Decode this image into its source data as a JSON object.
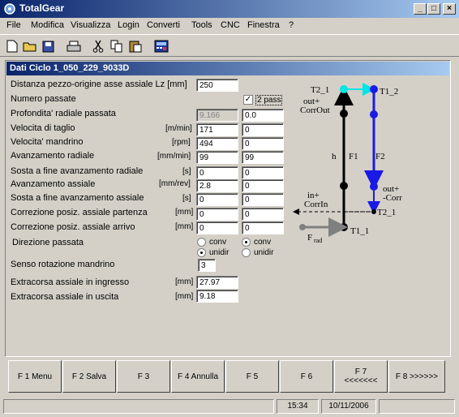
{
  "window": {
    "title": "TotalGear"
  },
  "menu": [
    "File",
    "Modifica",
    "Visualizza",
    "Login",
    "Converti",
    "Tools",
    "CNC",
    "Finestra",
    "?"
  ],
  "panel": {
    "title": "Dati Ciclo   1_050_229_9033D"
  },
  "fields": {
    "lz": {
      "label": "Distanza pezzo-origine asse  assiale  Lz  [mm]",
      "value": "250"
    },
    "passate": {
      "label": "Numero passate",
      "check_label": "2 pass",
      "checked": true
    },
    "profondita": {
      "label": "Profondita' radiale passata",
      "v1": "9.166",
      "v2": "0.0"
    },
    "vtaglio": {
      "label": "Velocita di taglio",
      "unit": "[m/min]",
      "v1": "171",
      "v2": "0"
    },
    "vmandrino": {
      "label": "Velocita' mandrino",
      "unit": "[rpm]",
      "v1": "494",
      "v2": "0"
    },
    "avrad": {
      "label": "Avanzamento radiale",
      "unit": "[mm/min]",
      "v1": "99",
      "v2": "99"
    },
    "sostarad": {
      "label": "Sosta a fine avanzamento radiale",
      "unit": "[s]",
      "v1": "0",
      "v2": "0"
    },
    "avass": {
      "label": "Avanzamento assiale",
      "unit": "[mm/rev]",
      "v1": "2.8",
      "v2": "0"
    },
    "sostaass": {
      "label": "Sosta a fine avanzamento assiale",
      "unit": "[s]",
      "v1": "0",
      "v2": "0"
    },
    "corrpart": {
      "label": "Correzione posiz. assiale partenza",
      "unit": "[mm]",
      "v1": "0",
      "v2": "0"
    },
    "corrarr": {
      "label": " Correzione posiz. assiale arrivo",
      "unit": "[mm]",
      "v1": "0",
      "v2": "0"
    },
    "direzione": {
      "label": "Direzione passata",
      "opt1": "conv",
      "opt2": "unidir"
    },
    "senso": {
      "label": "Senso rotazione mandrino",
      "value": "3"
    },
    "extraing": {
      "label": "Extracorsa assiale in ingresso",
      "unit": "[mm]",
      "value": "27.97"
    },
    "extrauscita": {
      "label": "Extracorsa assiale in uscita",
      "unit": "[mm]",
      "value": "9.18"
    }
  },
  "diagram": {
    "t2_1top": "T2_1",
    "t1_2": "T1_2",
    "outCorrOut1": "out+",
    "outCorrOut2": "CorrOut",
    "h": "h",
    "f1": "F1",
    "f2": "F2",
    "outCorr1": "out+",
    "outCorr2": "-Corr",
    "inCorr1": "in+",
    "inCorr2": "CorrIn",
    "t2_1": "T2_1",
    "t1_1": "T1_1",
    "frad": "F",
    "frad_sub": "rad"
  },
  "fkeys": [
    {
      "l1": "F 1    Menu",
      "l2": ""
    },
    {
      "l1": "F 2   Salva",
      "l2": ""
    },
    {
      "l1": "F 3",
      "l2": ""
    },
    {
      "l1": "F 4 Annulla",
      "l2": ""
    },
    {
      "l1": "F 5",
      "l2": ""
    },
    {
      "l1": "F 6",
      "l2": ""
    },
    {
      "l1": "F 7",
      "l2": "<<<<<<<"
    },
    {
      "l1": "F 8 >>>>>>",
      "l2": ""
    }
  ],
  "status": {
    "time": "15:34",
    "date": "10/11/2006"
  },
  "colors": {
    "title_start": "#0a246a",
    "title_end": "#a6caf0",
    "cyan": "#00e5e5",
    "blue": "#1a1ae6"
  }
}
